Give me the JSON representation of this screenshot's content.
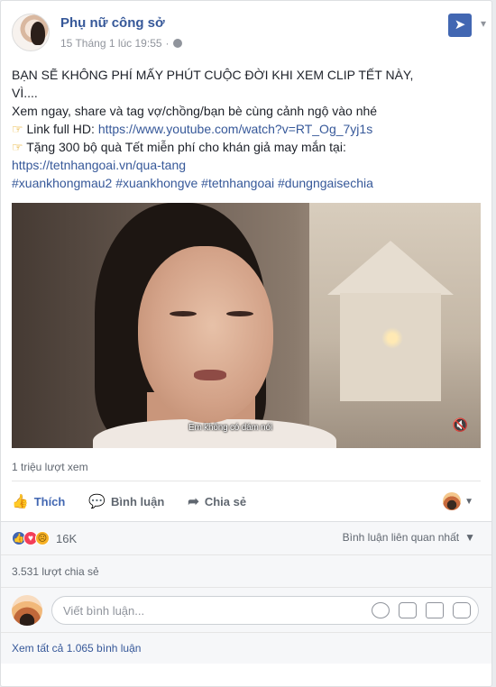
{
  "post": {
    "page_name": "Phụ nữ công sở",
    "timestamp": "15 Tháng 1 lúc 19:55",
    "separator": "·",
    "pin_icon": "pin-icon",
    "text": {
      "line1": "BẠN SẼ KHÔNG PHÍ MẤY PHÚT CUỘC ĐỜI KHI XEM CLIP TẾT NÀY,",
      "line2": "VÌ....",
      "line3": "Xem ngay, share và tag vợ/chồng/bạn bè cùng cảnh ngộ vào nhé",
      "line4_prefix": "Link full HD: ",
      "line4_link": "https://www.youtube.com/watch?v=RT_Og_7yj1s",
      "line5": "Tặng 300 bộ quà Tết miễn phí cho khán giả may mắn tại:",
      "line6_link": "https://tetnhangoai.vn/qua-tang",
      "hashtags": "#xuankhongmau2 #xuankhongve #tetnhangoai #dungngaisechia"
    },
    "video": {
      "subtitle": "Em không có dám nói"
    }
  },
  "stats": {
    "views": "1 triệu lượt xem",
    "reaction_count": "16K",
    "shares": "3.531 lượt chia sẻ"
  },
  "actions": {
    "like": "Thích",
    "comment": "Bình luận",
    "share": "Chia sẻ"
  },
  "comments": {
    "sort_label": "Bình luận liên quan nhất",
    "placeholder": "Viết bình luận...",
    "view_all": "Xem tất cả 1.065 bình luận"
  },
  "colors": {
    "link": "#365899",
    "like_blue": "#4267b2",
    "love_red": "#f33e58",
    "sad_yellow": "#f7b125"
  }
}
